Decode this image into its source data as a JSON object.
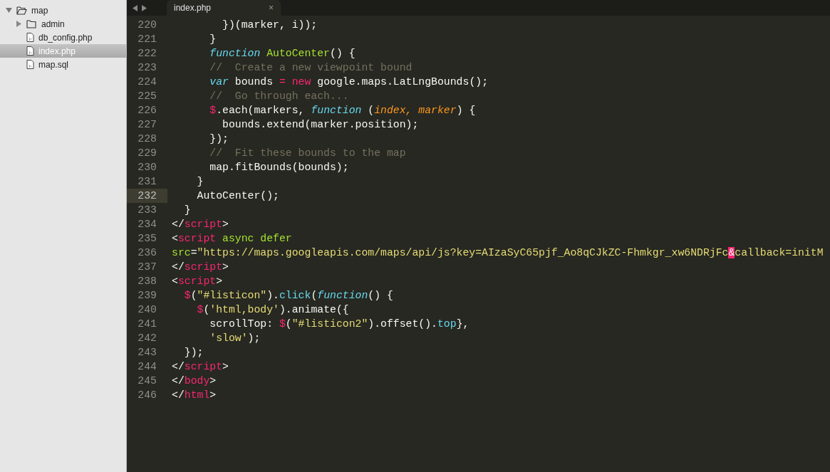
{
  "sidebar": {
    "tree": [
      {
        "name": "map",
        "kind": "folder",
        "expanded": true,
        "selected": false,
        "children": [
          {
            "name": "admin",
            "kind": "folder",
            "expanded": false,
            "selected": false
          },
          {
            "name": "db_config.php",
            "kind": "file",
            "selected": false
          },
          {
            "name": "index.php",
            "kind": "file",
            "selected": true
          },
          {
            "name": "map.sql",
            "kind": "file",
            "selected": false
          }
        ]
      }
    ]
  },
  "tabs": [
    {
      "label": "index.php",
      "selected": true,
      "close": "×"
    }
  ],
  "editor": {
    "lines": [
      {
        "number": "220",
        "current": false,
        "tokens": [
          {
            "text": "        })(marker, i));",
            "kind": "plain"
          }
        ]
      },
      {
        "number": "221",
        "current": false,
        "tokens": [
          {
            "text": "      }",
            "kind": "plain"
          }
        ]
      },
      {
        "number": "222",
        "current": false,
        "tokens": [
          {
            "text": "      function",
            "kind": "storage"
          },
          {
            "text": " AutoCenter",
            "kind": "entity"
          },
          {
            "text": "() {",
            "kind": "plain"
          }
        ]
      },
      {
        "number": "223",
        "current": false,
        "tokens": [
          {
            "text": "      //  Create a new viewpoint bound",
            "kind": "comment"
          }
        ]
      },
      {
        "number": "224",
        "current": false,
        "tokens": [
          {
            "text": "      var",
            "kind": "storage"
          },
          {
            "text": " bounds ",
            "kind": "plain"
          },
          {
            "text": "=",
            "kind": "keyword"
          },
          {
            "text": " new",
            "kind": "keyword"
          },
          {
            "text": " google.maps.LatLngBounds();",
            "kind": "plain"
          }
        ]
      },
      {
        "number": "225",
        "current": false,
        "tokens": [
          {
            "text": "      //  Go through each...",
            "kind": "comment"
          }
        ]
      },
      {
        "number": "226",
        "current": false,
        "tokens": [
          {
            "text": "      $",
            "kind": "keyword"
          },
          {
            "text": ".each(markers, ",
            "kind": "plain"
          },
          {
            "text": "function",
            "kind": "storage"
          },
          {
            "text": " (",
            "kind": "plain"
          },
          {
            "text": "index, marker",
            "kind": "param"
          },
          {
            "text": ") {",
            "kind": "plain"
          }
        ]
      },
      {
        "number": "227",
        "current": false,
        "tokens": [
          {
            "text": "        bounds.extend(marker.position);",
            "kind": "plain"
          }
        ]
      },
      {
        "number": "228",
        "current": false,
        "tokens": [
          {
            "text": "      });",
            "kind": "plain"
          }
        ]
      },
      {
        "number": "229",
        "current": false,
        "tokens": [
          {
            "text": "      //  Fit these bounds to the map",
            "kind": "comment"
          }
        ]
      },
      {
        "number": "230",
        "current": false,
        "tokens": [
          {
            "text": "      map.fitBounds(bounds);",
            "kind": "plain"
          }
        ]
      },
      {
        "number": "231",
        "current": false,
        "tokens": [
          {
            "text": "    }",
            "kind": "plain"
          }
        ]
      },
      {
        "number": "232",
        "current": true,
        "tokens": [
          {
            "text": "    AutoCenter();",
            "kind": "plain"
          }
        ]
      },
      {
        "number": "233",
        "current": false,
        "tokens": [
          {
            "text": "  }",
            "kind": "plain"
          }
        ]
      },
      {
        "number": "234",
        "current": false,
        "tokens": [
          {
            "text": "</",
            "kind": "plain"
          },
          {
            "text": "script",
            "kind": "keyword"
          },
          {
            "text": ">",
            "kind": "plain"
          }
        ]
      },
      {
        "number": "235",
        "current": false,
        "tokens": [
          {
            "text": "<",
            "kind": "plain"
          },
          {
            "text": "script",
            "kind": "keyword"
          },
          {
            "text": " async defer",
            "kind": "entity"
          }
        ]
      },
      {
        "number": "236",
        "current": false,
        "tokens": [
          {
            "text": "src",
            "kind": "entity"
          },
          {
            "text": "=",
            "kind": "plain"
          },
          {
            "text": "\"https://maps.googleapis.com/maps/api/js?key=AIzaSyC65pjf_Ao8qCJkZC-Fhmkgr_xw6NDRjFc",
            "kind": "string"
          },
          {
            "text": "&",
            "kind": "invalid"
          },
          {
            "text": "callback=initM",
            "kind": "string"
          }
        ]
      },
      {
        "number": "237",
        "current": false,
        "tokens": [
          {
            "text": "</",
            "kind": "plain"
          },
          {
            "text": "script",
            "kind": "keyword"
          },
          {
            "text": ">",
            "kind": "plain"
          }
        ]
      },
      {
        "number": "238",
        "current": false,
        "tokens": [
          {
            "text": "<",
            "kind": "plain"
          },
          {
            "text": "script",
            "kind": "keyword"
          },
          {
            "text": ">",
            "kind": "plain"
          }
        ]
      },
      {
        "number": "239",
        "current": false,
        "tokens": [
          {
            "text": "  $",
            "kind": "keyword"
          },
          {
            "text": "(",
            "kind": "plain"
          },
          {
            "text": "\"#listicon\"",
            "kind": "string"
          },
          {
            "text": ").",
            "kind": "plain"
          },
          {
            "text": "click",
            "kind": "support"
          },
          {
            "text": "(",
            "kind": "plain"
          },
          {
            "text": "function",
            "kind": "storage"
          },
          {
            "text": "() {",
            "kind": "plain"
          }
        ]
      },
      {
        "number": "240",
        "current": false,
        "tokens": [
          {
            "text": "    $",
            "kind": "keyword"
          },
          {
            "text": "(",
            "kind": "plain"
          },
          {
            "text": "'html,body'",
            "kind": "string"
          },
          {
            "text": ").animate({",
            "kind": "plain"
          }
        ]
      },
      {
        "number": "241",
        "current": false,
        "tokens": [
          {
            "text": "      scrollTop: ",
            "kind": "plain"
          },
          {
            "text": "$",
            "kind": "keyword"
          },
          {
            "text": "(",
            "kind": "plain"
          },
          {
            "text": "\"#listicon2\"",
            "kind": "string"
          },
          {
            "text": ").offset().",
            "kind": "plain"
          },
          {
            "text": "top",
            "kind": "support"
          },
          {
            "text": "},",
            "kind": "plain"
          }
        ]
      },
      {
        "number": "242",
        "current": false,
        "tokens": [
          {
            "text": "      'slow'",
            "kind": "string"
          },
          {
            "text": ");",
            "kind": "plain"
          }
        ]
      },
      {
        "number": "243",
        "current": false,
        "tokens": [
          {
            "text": "  });",
            "kind": "plain"
          }
        ]
      },
      {
        "number": "244",
        "current": false,
        "tokens": [
          {
            "text": "</",
            "kind": "plain"
          },
          {
            "text": "script",
            "kind": "keyword"
          },
          {
            "text": ">",
            "kind": "plain"
          }
        ]
      },
      {
        "number": "245",
        "current": false,
        "tokens": [
          {
            "text": "</",
            "kind": "plain"
          },
          {
            "text": "body",
            "kind": "keyword"
          },
          {
            "text": ">",
            "kind": "plain"
          }
        ]
      },
      {
        "number": "246",
        "current": false,
        "tokens": [
          {
            "text": "</",
            "kind": "plain"
          },
          {
            "text": "html",
            "kind": "keyword"
          },
          {
            "text": ">",
            "kind": "plain"
          }
        ]
      }
    ]
  }
}
